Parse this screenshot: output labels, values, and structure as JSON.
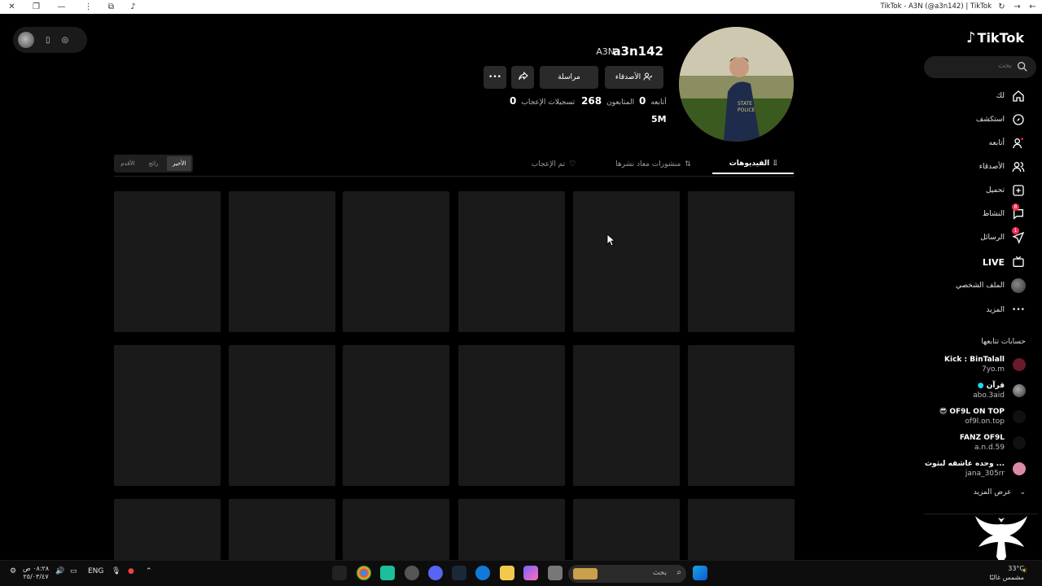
{
  "window": {
    "title": "TikTok - A3N (@a3n142) | TikTok"
  },
  "brand": {
    "name": "TikTok"
  },
  "search": {
    "placeholder": "بحث"
  },
  "nav": {
    "items": [
      {
        "label": "لك",
        "icon": "home-icon"
      },
      {
        "label": "استكشف",
        "icon": "compass-icon"
      },
      {
        "label": "أتابعه",
        "icon": "following-icon"
      },
      {
        "label": "الأصدقاء",
        "icon": "friends-icon"
      },
      {
        "label": "تحميل",
        "icon": "upload-icon"
      },
      {
        "label": "النشاط",
        "icon": "activity-icon",
        "badge": "8"
      },
      {
        "label": "الرسائل",
        "icon": "messages-icon",
        "badge": "1"
      },
      {
        "label": "LIVE",
        "icon": "live-icon"
      },
      {
        "label": "الملف الشخصي",
        "icon": "profile-avatar"
      },
      {
        "label": "المزيد",
        "icon": "more-icon"
      }
    ]
  },
  "following": {
    "title": "حسابات تتابعها",
    "accounts": [
      {
        "name": "Kick : BinTalall",
        "username": "7yo.m",
        "color": "#6a1a2a"
      },
      {
        "name": "قرآن",
        "username": "abo.3aid",
        "color": "#555555"
      },
      {
        "name": "OF9L ON TOP",
        "username": "of9l.on.top",
        "color": "#111111"
      },
      {
        "name": "FANZ OF9L",
        "username": "a.n.d.59",
        "color": "#111111"
      },
      {
        "name": "وحده عاشقه لبثوث ...",
        "username": "jana_305rr",
        "color": "#d98aa6"
      }
    ],
    "show_more": "عرض المزيد"
  },
  "profile": {
    "username": "a3n142",
    "nickname": "A3N",
    "buttons": {
      "friends": "الأصدقاء",
      "message": "مراسلة"
    },
    "stats": {
      "following_label": "أتابعه",
      "following": "0",
      "followers_label": "المتابعون",
      "followers": "268",
      "likes_label": "تسجيلات الإعجاب",
      "likes": "0"
    },
    "bio": "5M"
  },
  "tabs": [
    {
      "label": "الفيديوهات",
      "active": true
    },
    {
      "label": "منشورات معاد نشرها",
      "active": false
    },
    {
      "label": "تم الإعجاب",
      "active": false
    }
  ],
  "sort": {
    "options": [
      {
        "label": "الأقدم",
        "active": false
      },
      {
        "label": "رائج",
        "active": false
      },
      {
        "label": "الأخير",
        "active": true
      }
    ]
  },
  "taskbar": {
    "time": "٠٨:٢٨ ص",
    "date": "٢٥/٠٣/٤٧",
    "lang": "ENG",
    "search_placeholder": "بحث",
    "weather_temp": "33°C",
    "weather_desc": "مشمس غالبًا"
  },
  "colors": {
    "accent": "#fe2c55",
    "background": "#000000",
    "tile": "#1a1a1a"
  }
}
